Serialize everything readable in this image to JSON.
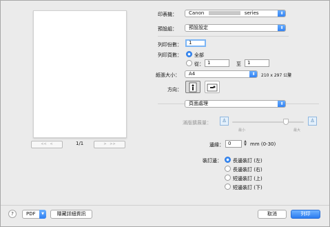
{
  "printer": {
    "label": "印表機：",
    "value": "Canon",
    "suffix": "series"
  },
  "presets": {
    "label": "預設組：",
    "value": "預設設定"
  },
  "copies": {
    "label": "列印份數：",
    "value": "1"
  },
  "pages": {
    "label": "列印頁數：",
    "all_label": "全部",
    "from_label": "從：",
    "from_value": "1",
    "to_label": "至",
    "to_value": "1"
  },
  "paper_size": {
    "label": "紙張大小：",
    "value": "A4",
    "dims": "210 x 297 公釐"
  },
  "orientation": {
    "label": "方向："
  },
  "section_popup": {
    "value": "頁面處理"
  },
  "expansion": {
    "label": "滿版擴展量：",
    "min_label": "最小",
    "max_label": "最大",
    "level": 0.75
  },
  "margin": {
    "label": "邊緣：",
    "value": "0",
    "unit": "mm (0-30)"
  },
  "stapling": {
    "label": "裝訂邊：",
    "options": [
      "長邊裝訂 (左)",
      "長邊裝訂 (右)",
      "短邊裝訂 (上)",
      "短邊裝訂 (下)"
    ],
    "selected": 0
  },
  "preview": {
    "page_counter": "1/1"
  },
  "footer": {
    "help": "?",
    "pdf": "PDF",
    "hide_details": "隱藏詳細資訊",
    "cancel": "取消",
    "print": "列印"
  },
  "colors": {
    "accent": "#3a8df5"
  }
}
